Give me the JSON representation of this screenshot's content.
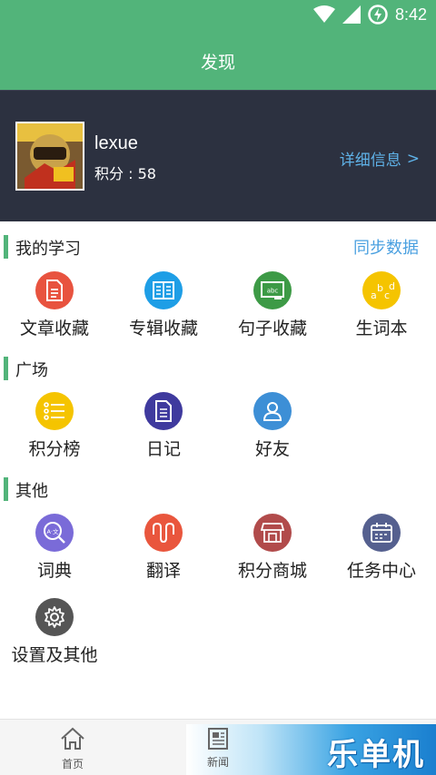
{
  "status_bar": {
    "time": "8:42"
  },
  "header": {
    "title": "发现"
  },
  "profile": {
    "username": "lexue",
    "points": "积分 : 58",
    "detail_link": "详细信息",
    "detail_chevron": ">"
  },
  "sections": {
    "my_study": {
      "title": "我的学习",
      "sync_label": "同步数据",
      "items": [
        {
          "label": "文章收藏",
          "color": "#e8533f",
          "icon": "document-icon"
        },
        {
          "label": "专辑收藏",
          "color": "#1e9ee6",
          "icon": "book-icon"
        },
        {
          "label": "句子收藏",
          "color": "#3d9a46",
          "icon": "chalkboard-icon"
        },
        {
          "label": "生词本",
          "color": "#f5c400",
          "icon": "abc-icon"
        }
      ]
    },
    "square": {
      "title": "广场",
      "items": [
        {
          "label": "积分榜",
          "color": "#f5c400",
          "icon": "list-icon"
        },
        {
          "label": "日记",
          "color": "#3f3a9e",
          "icon": "diary-icon"
        },
        {
          "label": "好友",
          "color": "#3d8fd6",
          "icon": "person-icon"
        }
      ]
    },
    "other": {
      "title": "其他",
      "items": [
        {
          "label": "词典",
          "color": "#7a6bd8",
          "icon": "dictionary-icon"
        },
        {
          "label": "翻译",
          "color": "#e9563d",
          "icon": "translate-wave-icon"
        },
        {
          "label": "积分商城",
          "color": "#b14b4b",
          "icon": "store-icon"
        },
        {
          "label": "任务中心",
          "color": "#55608f",
          "icon": "calendar-icon"
        },
        {
          "label": "设置及其他",
          "color": "#555555",
          "icon": "gear-icon"
        }
      ]
    }
  },
  "bottom_nav": {
    "tabs": [
      {
        "label": "首页",
        "icon": "home-icon"
      },
      {
        "label": "新闻",
        "icon": "news-icon"
      }
    ]
  },
  "watermark": {
    "text": "乐单机"
  },
  "theme": {
    "accent": "#52b47a",
    "profile_bg": "#2c3140",
    "link": "#4aa0e0"
  }
}
